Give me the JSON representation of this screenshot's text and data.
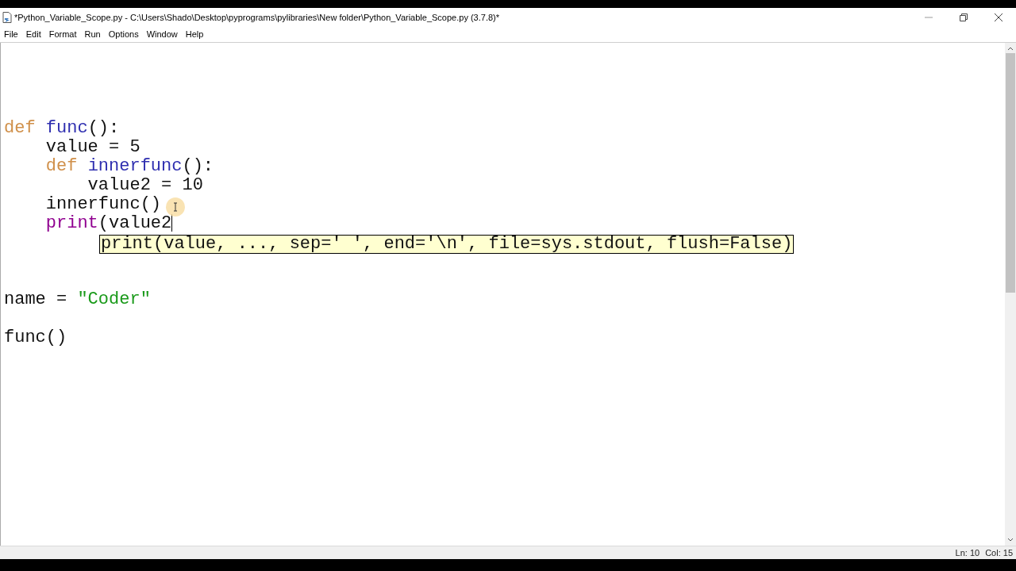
{
  "window": {
    "title": "*Python_Variable_Scope.py - C:\\Users\\Shado\\Desktop\\pyprograms\\pylibraries\\New folder\\Python_Variable_Scope.py (3.7.8)*"
  },
  "menu": [
    "File",
    "Edit",
    "Format",
    "Run",
    "Options",
    "Window",
    "Help"
  ],
  "editor": {
    "lines": [
      {
        "kind": "blank"
      },
      {
        "kind": "blank"
      },
      {
        "kind": "blank"
      },
      {
        "kind": "blank"
      },
      {
        "kind": "code",
        "tokens": [
          {
            "kind": "keyword",
            "text": "def "
          },
          {
            "kind": "definition",
            "text": "func"
          },
          {
            "kind": "plain",
            "text": "():"
          }
        ]
      },
      {
        "kind": "code",
        "tokens": [
          {
            "kind": "plain",
            "text": "    value = 5"
          }
        ]
      },
      {
        "kind": "code",
        "tokens": [
          {
            "kind": "keyword",
            "text": "    def "
          },
          {
            "kind": "definition",
            "text": "innerfunc"
          },
          {
            "kind": "plain",
            "text": "():"
          }
        ]
      },
      {
        "kind": "code",
        "tokens": [
          {
            "kind": "plain",
            "text": "        value2 = 10"
          }
        ]
      },
      {
        "kind": "code",
        "tokens": [
          {
            "kind": "plain",
            "text": "    innerfunc()"
          }
        ]
      },
      {
        "kind": "code",
        "cursor": true,
        "tokens": [
          {
            "kind": "builtin",
            "text": "    print"
          },
          {
            "kind": "plain",
            "text": "(value2"
          }
        ]
      },
      {
        "kind": "blank"
      },
      {
        "kind": "blank"
      },
      {
        "kind": "blank"
      },
      {
        "kind": "code",
        "tokens": [
          {
            "kind": "plain",
            "text": "name = "
          },
          {
            "kind": "string",
            "text": "\"Coder\""
          }
        ]
      },
      {
        "kind": "blank"
      },
      {
        "kind": "code",
        "tokens": [
          {
            "kind": "plain",
            "text": "func()"
          }
        ]
      }
    ],
    "calltip": "print(value, ..., sep=' ', end='\\n', file=sys.stdout, flush=False)"
  },
  "status_bar": {
    "line": "Ln: 10",
    "column": "Col: 15"
  }
}
